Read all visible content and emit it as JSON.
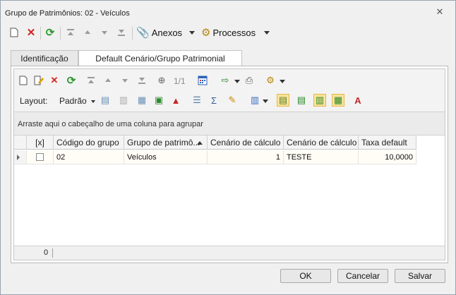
{
  "window": {
    "title": "Grupo de Patrimônios: 02 - Veículos"
  },
  "toolbar": {
    "anexos_label": "Anexos",
    "processos_label": "Processos"
  },
  "tabs": [
    {
      "label": "Identificação"
    },
    {
      "label": "Default Cenário/Grupo Patrimonial"
    }
  ],
  "grid_toolbar": {
    "page_indicator": "1/1",
    "layout_label": "Layout:",
    "layout_value": "Padrão"
  },
  "group_bar": {
    "hint": "Arraste aqui o cabeçalho de uma coluna para agrupar"
  },
  "table": {
    "headers": [
      "[x]",
      "Código do grupo",
      "Grupo de patrimô...",
      "Cenário de cálculo",
      "Cenário de cálculo",
      "Taxa default"
    ],
    "rows": [
      {
        "codigo": "02",
        "grupo": "Veículos",
        "cenario_num": "1",
        "cenario_nome": "TESTE",
        "taxa": "10,0000"
      }
    ]
  },
  "footer": {
    "count": "0"
  },
  "buttons": {
    "ok": "OK",
    "cancel": "Cancelar",
    "save": "Salvar"
  }
}
